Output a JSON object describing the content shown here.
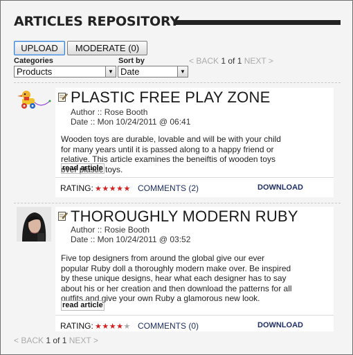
{
  "header": {
    "title": "ARTICLES REPOSITORY"
  },
  "toolbar": {
    "upload_label": "UPLOAD",
    "moderate_label": "MODERATE (0)"
  },
  "filters": {
    "categories_label": "Categories",
    "categories_value": "Products",
    "sort_label": "Sort by",
    "sort_value": "Date"
  },
  "pager": {
    "back": "< BACK",
    "current": "1 of 1",
    "next": "NEXT >"
  },
  "articles": [
    {
      "title": "PLASTIC FREE PLAY ZONE",
      "author": "Author :: Rose Booth",
      "date": "Date :: Mon 10/24/2011 @ 06:41",
      "summary": "Wooden toys are durable, lovable and will be with your child for many years until it is passed along to a happy friend or relative. This article examines the beneiftis of wooden toys over plastic toys.",
      "read_label": "read article",
      "rating_label": "RATING:",
      "rating": 5,
      "comments": "COMMENTS (2)",
      "download": "DOWNLOAD",
      "thumb_icon": "wooden-toy-icon"
    },
    {
      "title": "THOROUGHLY MODERN RUBY",
      "author": "Author :: Rosie Booth",
      "date": "Date :: Mon 10/24/2011 @ 03:52",
      "summary": "Five top designers from around the global give our ever popular Ruby doll a thoroughly modern make over. Be inspired by these unique designs, hear what each designer has to say about his or her creation and then download the patterns for all outfits and give your own Ruby a glamorous new look.",
      "read_label": "read article",
      "rating_label": "RATING:",
      "rating": 4,
      "comments": "COMMENTS (0)",
      "download": "DOWNLOAD",
      "thumb_icon": "portrait-photo-icon"
    }
  ],
  "colors": {
    "header_rule": "#222222",
    "star": "#d21e1e",
    "link": "#1f2f66"
  }
}
